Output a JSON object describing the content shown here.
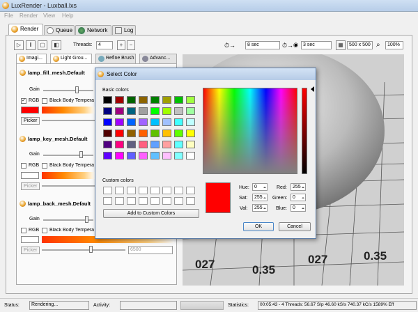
{
  "app": {
    "title": "LuxRender - Luxball.lxs"
  },
  "menu": [
    "File",
    "Render",
    "View",
    "Help"
  ],
  "main_tabs": [
    {
      "label": "Render"
    },
    {
      "label": "Queue"
    },
    {
      "label": "Network"
    },
    {
      "label": "Log"
    }
  ],
  "toolbar": {
    "threads_label": "Threads:",
    "threads_value": "4",
    "halt_time": "8 sec",
    "refresh_time": "3 sec",
    "resolution": "500 x 500",
    "zoom": "100%"
  },
  "left_tabs": [
    "Imagi...",
    "Light Grou...",
    "Refine Brush",
    "Advanc..."
  ],
  "light_groups": [
    {
      "name": "lamp_fill_mesh.Default",
      "gain_label": "Gain",
      "rgb_label": "RGB",
      "rgb_checked": true,
      "bb_label": "Black Body Temperature",
      "picker_label": "Picker",
      "color": "#ff0000",
      "enabled": true
    },
    {
      "name": "lamp_key_mesh.Default",
      "gain_label": "Gain",
      "rgb_label": "RGB",
      "rgb_checked": false,
      "bb_label": "Black Body Temperature",
      "picker_label": "Picker",
      "color": "#ffffff",
      "enabled": false
    },
    {
      "name": "lamp_back_mesh.Default",
      "gain_label": "Gain",
      "rgb_label": "RGB",
      "rgb_checked": false,
      "bb_label": "Black Body Temperature",
      "picker_label": "Picker",
      "color": "#ffffff",
      "enabled": false,
      "temperature": "6500"
    }
  ],
  "dialog": {
    "title": "Select Color",
    "basic_colors_label": "Basic colors",
    "custom_colors_label": "Custom colors",
    "add_custom_label": "Add to Custom Colors",
    "basic_colors": [
      "#000000",
      "#a00000",
      "#006400",
      "#8c6400",
      "#008000",
      "#a0a000",
      "#00c000",
      "#a0ff40",
      "#000080",
      "#a00080",
      "#006480",
      "#a0a0a0",
      "#00ff00",
      "#a0ff00",
      "#c0c0c0",
      "#a0ffa0",
      "#0000ff",
      "#a000ff",
      "#0064ff",
      "#a064ff",
      "#00c0ff",
      "#a0c0ff",
      "#40ffff",
      "#c0ffff",
      "#500000",
      "#ff0000",
      "#906000",
      "#ff6000",
      "#60c000",
      "#ffc000",
      "#60ff00",
      "#ffff00",
      "#500080",
      "#ff0080",
      "#606080",
      "#ff6080",
      "#60a0ff",
      "#ffa0a0",
      "#60ffff",
      "#ffffc0",
      "#6000ff",
      "#ff00ff",
      "#6060ff",
      "#ff60ff",
      "#60c0ff",
      "#ffc0ff",
      "#80ffff",
      "#ffffff"
    ],
    "current_color": "#ff0000",
    "hue_label": "Hue:",
    "hue": "0",
    "sat_label": "Sat:",
    "sat": "255",
    "val_label": "Val:",
    "val": "255",
    "red_label": "Red:",
    "red": "255",
    "green_label": "Green:",
    "green": "0",
    "blue_label": "Blue:",
    "blue": "0",
    "ok_label": "OK",
    "cancel_label": "Cancel"
  },
  "render_numbers": [
    "027",
    "0.35",
    "027",
    "0.35"
  ],
  "status": {
    "status_label": "Status:",
    "status_value": "Rendering...",
    "activity_label": "Activity:",
    "statistics_label": "Statistics:",
    "statistics_value": "00:05:43 - 4 Threads: 56.67 S/p  46.60 kS/s  740.37 kC/s  1589% Eff"
  }
}
